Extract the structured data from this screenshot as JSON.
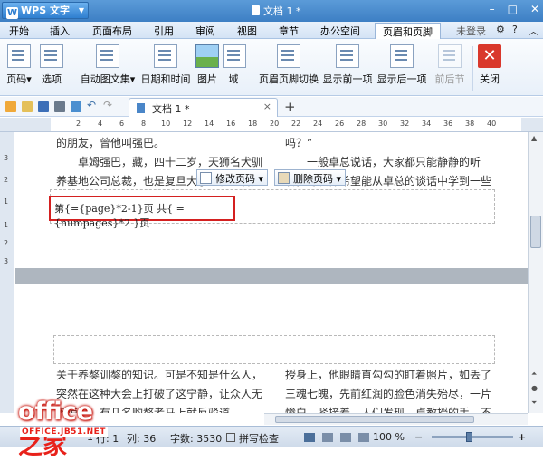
{
  "app": {
    "name": "WPS 文字",
    "title": "文档 1 *"
  },
  "menu": {
    "items": [
      "开始",
      "插入",
      "页面布局",
      "引用",
      "审阅",
      "视图",
      "章节",
      "办公空间",
      "页眉和页脚"
    ],
    "login": "未登录"
  },
  "ribbon": {
    "page_number": "页码",
    "options": "选项",
    "auto_text": "自动图文集",
    "date_time": "日期和时间",
    "picture": "图片",
    "field": "域",
    "switch": "页眉页脚切换",
    "show_prev": "显示前一项",
    "show_next": "显示后一项",
    "prev_section": "前后节",
    "close": "关闭"
  },
  "doc_tab": {
    "label": "文档 1 *"
  },
  "ruler": {
    "h_numbers": [
      "2",
      "4",
      "6",
      "8",
      "10",
      "12",
      "14",
      "16",
      "18",
      "20",
      "22",
      "24",
      "26",
      "28",
      "30",
      "32",
      "34",
      "36",
      "38",
      "40"
    ],
    "v_numbers": [
      "3",
      "2",
      "1",
      "1",
      "2",
      "3"
    ]
  },
  "page1": {
    "col_left": [
      "的朋友，曾他叫强巴。",
      "卓姆强巴，藏，四十二岁，天狮名犬驯",
      "养基地公司总裁，也是复旦大学生物系客座"
    ],
    "col_right": [
      "吗？”",
      "一般卓总说话，大家都只能静静的听",
      "着，每次都希望能从卓总的谈话中学到一些"
    ]
  },
  "field_code": "第{={page}*2-1}页 共{ ={numpages}*2 }页",
  "float_buttons": {
    "edit": "修改页码",
    "delete": "删除页码"
  },
  "page2": {
    "col_left": [
      "关于养獒训獒的知识。可是不知是什么人，",
      "突然在这种大会上打破了这宁静，让众人无",
      "不惊讶，有几名购獒者马上就反驳道"
    ],
    "col_right": [
      "授身上，他眼睛直勾勾的盯着照片，如丢了",
      "三魂七魄，先前红润的脸色消失殆尽，一片",
      "惨白，紧接着，人们发现，卓教授的手，不"
    ]
  },
  "status": {
    "page": "1",
    "line": "行: 1",
    "col": "列: 36",
    "word_count": "字数: 3530",
    "spell_check": "拼写检查",
    "zoom": "100 %"
  },
  "watermark": {
    "brand_latin": "office",
    "brand_zh": "之家",
    "url": "OFFICE.JB51.NET"
  }
}
